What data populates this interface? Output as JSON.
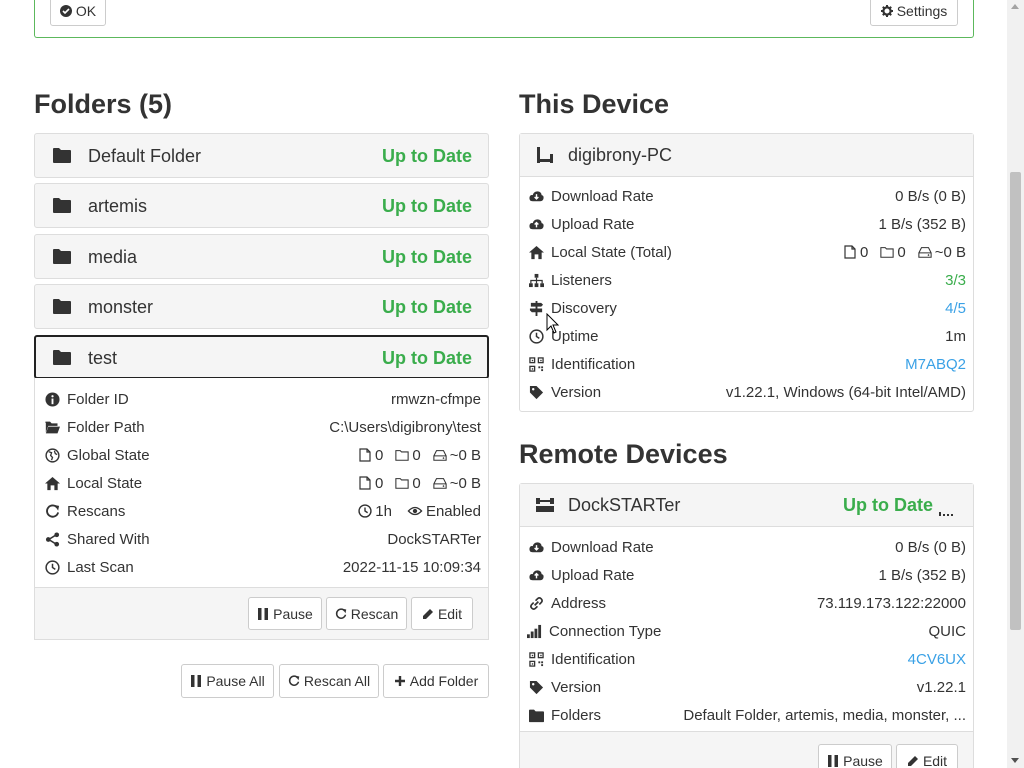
{
  "top_bar": {
    "ok_label": "OK",
    "settings_label": "Settings"
  },
  "folders": {
    "heading": "Folders (5)",
    "items": [
      {
        "name": "Default Folder",
        "status": "Up to Date"
      },
      {
        "name": "artemis",
        "status": "Up to Date"
      },
      {
        "name": "media",
        "status": "Up to Date"
      },
      {
        "name": "monster",
        "status": "Up to Date"
      },
      {
        "name": "test",
        "status": "Up to Date"
      }
    ],
    "details": {
      "folder_id_label": "Folder ID",
      "folder_id": "rmwzn-cfmpe",
      "folder_path_label": "Folder Path",
      "folder_path": "C:\\Users\\digibrony\\test",
      "global_state_label": "Global State",
      "global_files": "0",
      "global_dirs": "0",
      "global_size": "~0 B",
      "local_state_label": "Local State",
      "local_files": "0",
      "local_dirs": "0",
      "local_size": "~0 B",
      "rescans_label": "Rescans",
      "rescan_interval": "1h",
      "watch_status": "Enabled",
      "shared_with_label": "Shared With",
      "shared_with": "DockSTARTer",
      "last_scan_label": "Last Scan",
      "last_scan": "2022-11-15 10:09:34",
      "pause_label": "Pause",
      "rescan_label": "Rescan",
      "edit_label": "Edit"
    },
    "pause_all_label": "Pause All",
    "rescan_all_label": "Rescan All",
    "add_folder_label": "Add Folder"
  },
  "this_device": {
    "heading": "This Device",
    "name": "digibrony-PC",
    "download_rate_label": "Download Rate",
    "download_rate": "0 B/s (0 B)",
    "upload_rate_label": "Upload Rate",
    "upload_rate": "1 B/s (352 B)",
    "local_state_label": "Local State (Total)",
    "local_files": "0",
    "local_dirs": "0",
    "local_size": "~0 B",
    "listeners_label": "Listeners",
    "listeners": "3/3",
    "discovery_label": "Discovery",
    "discovery": "4/5",
    "uptime_label": "Uptime",
    "uptime": "1m",
    "identification_label": "Identification",
    "identification": "M7ABQ2",
    "version_label": "Version",
    "version": "v1.22.1, Windows (64-bit Intel/AMD)"
  },
  "remote_devices": {
    "heading": "Remote Devices",
    "device": {
      "name": "DockSTARTer",
      "status": "Up to Date",
      "download_rate_label": "Download Rate",
      "download_rate": "0 B/s (0 B)",
      "upload_rate_label": "Upload Rate",
      "upload_rate": "1 B/s (352 B)",
      "address_label": "Address",
      "address": "73.119.173.122:22000",
      "connection_type_label": "Connection Type",
      "connection_type": "QUIC",
      "identification_label": "Identification",
      "identification": "4CV6UX",
      "version_label": "Version",
      "version": "v1.22.1",
      "folders_label": "Folders",
      "folders": "Default Folder, artemis, media, monster, ...",
      "pause_label": "Pause",
      "edit_label": "Edit"
    }
  },
  "colors": {
    "success": "#3aad4c",
    "link": "#3aa1e6",
    "panel_bg": "#f5f5f5",
    "border": "#dddddd"
  }
}
